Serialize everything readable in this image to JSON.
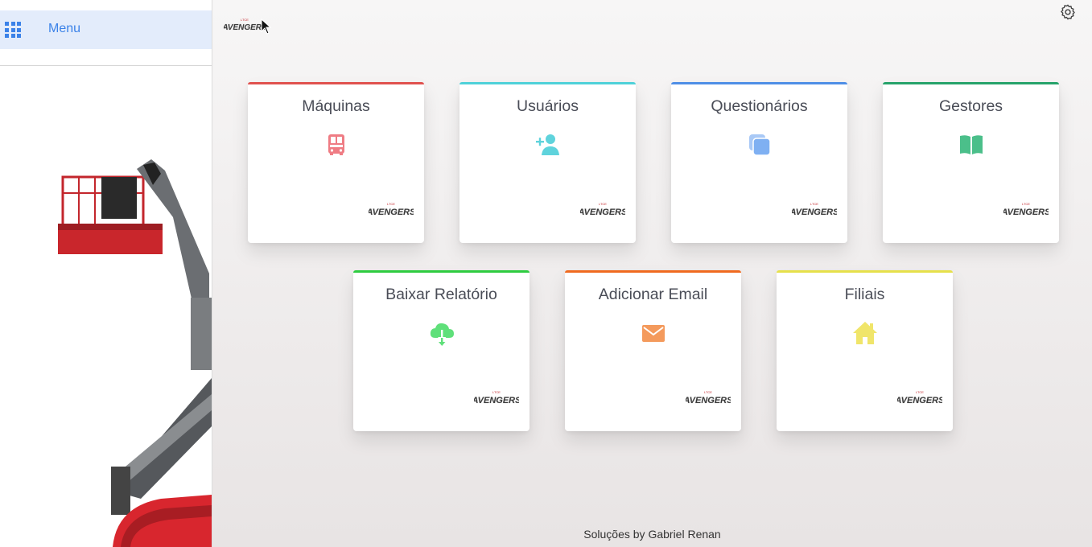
{
  "sidebar": {
    "menu_label": "Menu"
  },
  "logo_text": "AVENGERS",
  "cards": [
    {
      "title": "Máquinas",
      "color": "#e0524f",
      "icon": "bus-icon",
      "icon_color": "#ef7c84"
    },
    {
      "title": "Usuários",
      "color": "#4fd1d9",
      "icon": "add-user-icon",
      "icon_color": "#5fd3dc"
    },
    {
      "title": "Questionários",
      "color": "#4f8fe6",
      "icon": "copy-icon",
      "icon_color": "#7fb0f2"
    },
    {
      "title": "Gestores",
      "color": "#27a36b",
      "icon": "book-icon",
      "icon_color": "#4bbf8a"
    },
    {
      "title": "Baixar Relatório",
      "color": "#2ecc40",
      "icon": "cloud-download-icon",
      "icon_color": "#5fe07a"
    },
    {
      "title": "Adicionar Email",
      "color": "#f06a1f",
      "icon": "envelope-icon",
      "icon_color": "#f49a5c"
    },
    {
      "title": "Filiais",
      "color": "#e6e04a",
      "icon": "home-icon",
      "icon_color": "#f0e56a"
    }
  ],
  "footer": "Soluções by Gabriel Renan"
}
